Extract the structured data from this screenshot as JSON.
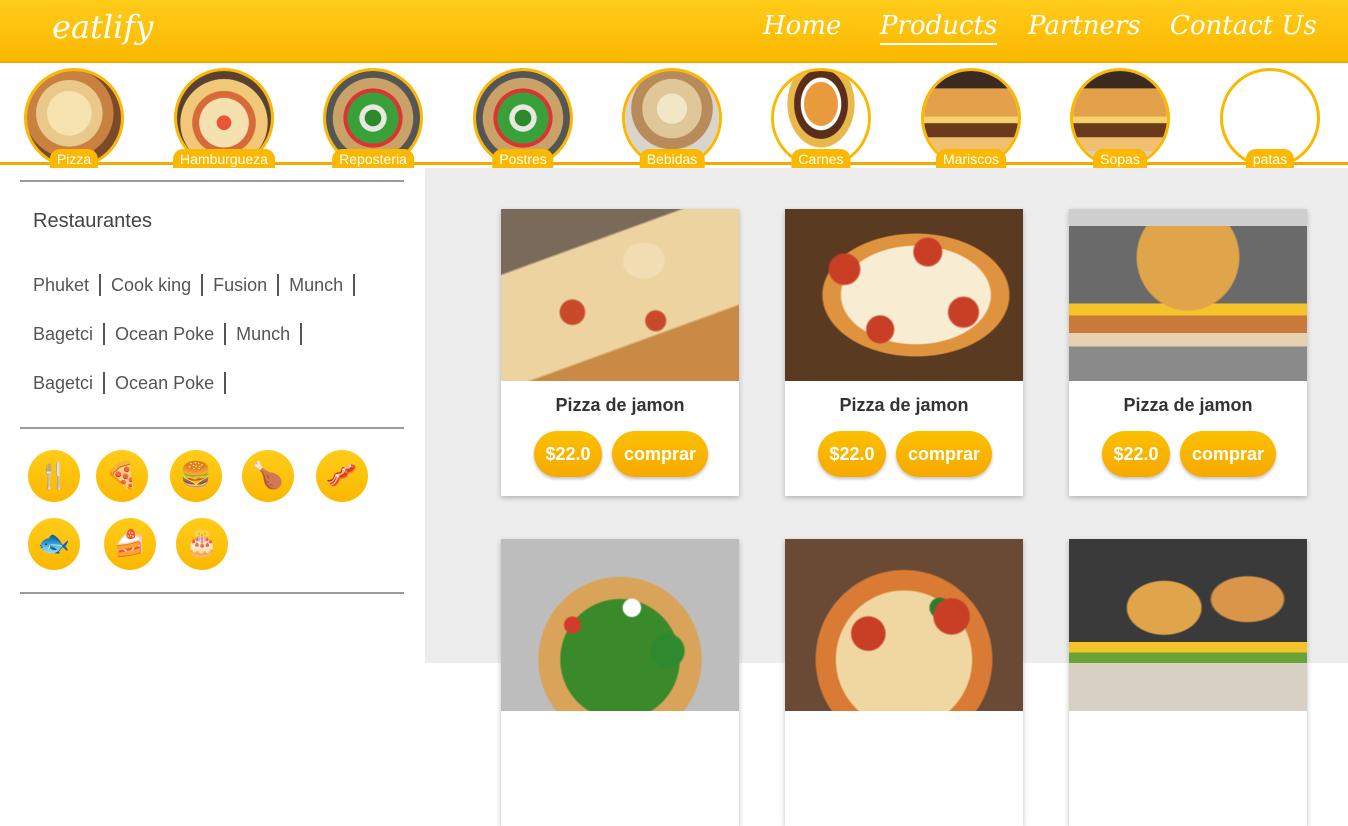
{
  "header": {
    "logo": "eatlify",
    "nav": [
      {
        "label": "Home",
        "active": false
      },
      {
        "label": "Products",
        "active": true
      },
      {
        "label": "Partners",
        "active": false
      },
      {
        "label": "Contact Us",
        "active": false
      }
    ]
  },
  "categories": [
    {
      "label": "Pizza",
      "image": "pizza-photo"
    },
    {
      "label": "Hamburgueza",
      "image": "pizza-photo"
    },
    {
      "label": "Reposteria",
      "image": "salad-pizza-photo"
    },
    {
      "label": "Postres",
      "image": "salad-pizza-photo"
    },
    {
      "label": "Bebidas",
      "image": "pizza-plate-photo"
    },
    {
      "label": "Carnes",
      "image": "burger-fries-photo"
    },
    {
      "label": "Mariscos",
      "image": "burger-photo"
    },
    {
      "label": "Sopas",
      "image": "burger-photo"
    },
    {
      "label": "patas",
      "image": ""
    }
  ],
  "sidebar": {
    "title": "Restaurantes",
    "restaurant_rows": [
      [
        "Phuket",
        "Cook king",
        "Fusion",
        "Munch"
      ],
      [
        "Bagetci",
        "Ocean Poke",
        "Munch"
      ],
      [
        "Bagetci",
        "Ocean Poke"
      ]
    ],
    "icons": [
      "utensils-icon",
      "pizza-slice-icon",
      "burger-icon",
      "drumstick-icon",
      "bacon-icon",
      "fish-icon",
      "cheese-cake-icon",
      "birthday-cake-icon"
    ]
  },
  "products": [
    {
      "name": "Pizza de jamon",
      "price": "$22.0",
      "buy_label": "comprar",
      "image": "pizza-slice-photo"
    },
    {
      "name": "Pizza de jamon",
      "price": "$22.0",
      "buy_label": "comprar",
      "image": "pepperoni-pizza-photo"
    },
    {
      "name": "Pizza de jamon",
      "price": "$22.0",
      "buy_label": "comprar",
      "image": "burger-photo"
    },
    {
      "name": "",
      "price": "",
      "buy_label": "",
      "image": "salad-pizza-photo"
    },
    {
      "name": "",
      "price": "",
      "buy_label": "",
      "image": "pepperoni-pizza-photo"
    },
    {
      "name": "",
      "price": "",
      "buy_label": "",
      "image": "burgers-photo"
    }
  ],
  "colors": {
    "accent": "#fbb800",
    "accent_light": "#ffcc1a",
    "main_bg": "#ededed"
  }
}
